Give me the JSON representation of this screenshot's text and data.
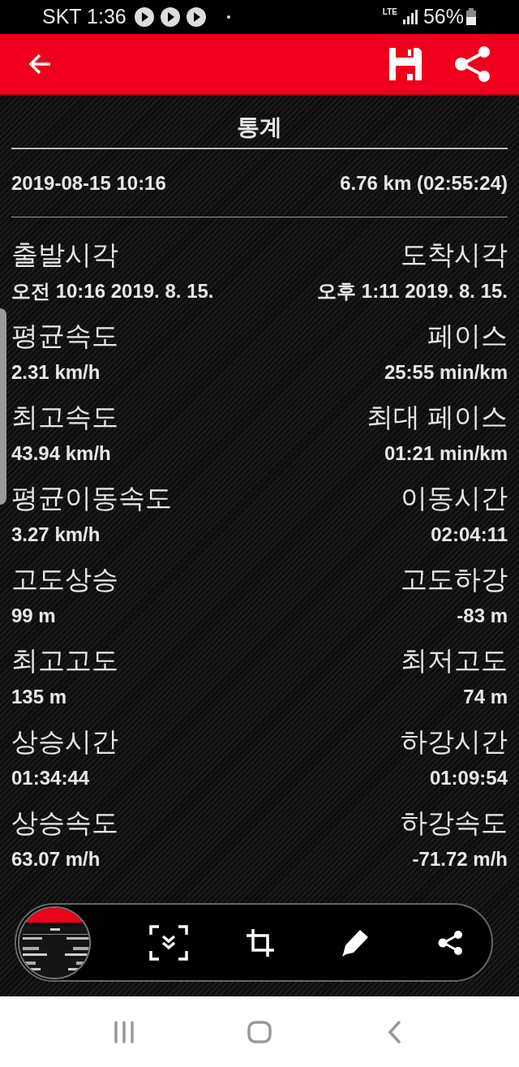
{
  "status_bar": {
    "time": "SKT 1:36",
    "network": "LTE",
    "battery": "56%"
  },
  "section_title": "통계",
  "summary": {
    "date": "2019-08-15 10:16",
    "distance": "6.76 km (02:55:24)"
  },
  "stats": [
    {
      "left_label": "출발시각",
      "left_value": "오전 10:16 2019. 8. 15.",
      "right_label": "도착시각",
      "right_value": "오후 1:11 2019. 8. 15."
    },
    {
      "left_label": "평균속도",
      "left_value": "2.31 km/h",
      "right_label": "페이스",
      "right_value": "25:55 min/km"
    },
    {
      "left_label": "최고속도",
      "left_value": "43.94 km/h",
      "right_label": "최대 페이스",
      "right_value": "01:21 min/km"
    },
    {
      "left_label": "평균이동속도",
      "left_value": "3.27 km/h",
      "right_label": "이동시간",
      "right_value": "02:04:11"
    },
    {
      "left_label": "고도상승",
      "left_value": "99 m",
      "right_label": "고도하강",
      "right_value": "-83 m"
    },
    {
      "left_label": "최고고도",
      "left_value": "135 m",
      "right_label": "최저고도",
      "right_value": "74 m"
    },
    {
      "left_label": "상승시간",
      "left_value": "01:34:44",
      "right_label": "하강시간",
      "right_value": "01:09:54"
    },
    {
      "left_label": "상승속도",
      "left_value": "63.07 m/h",
      "right_label": "하강속도",
      "right_value": "-71.72 m/h"
    }
  ]
}
